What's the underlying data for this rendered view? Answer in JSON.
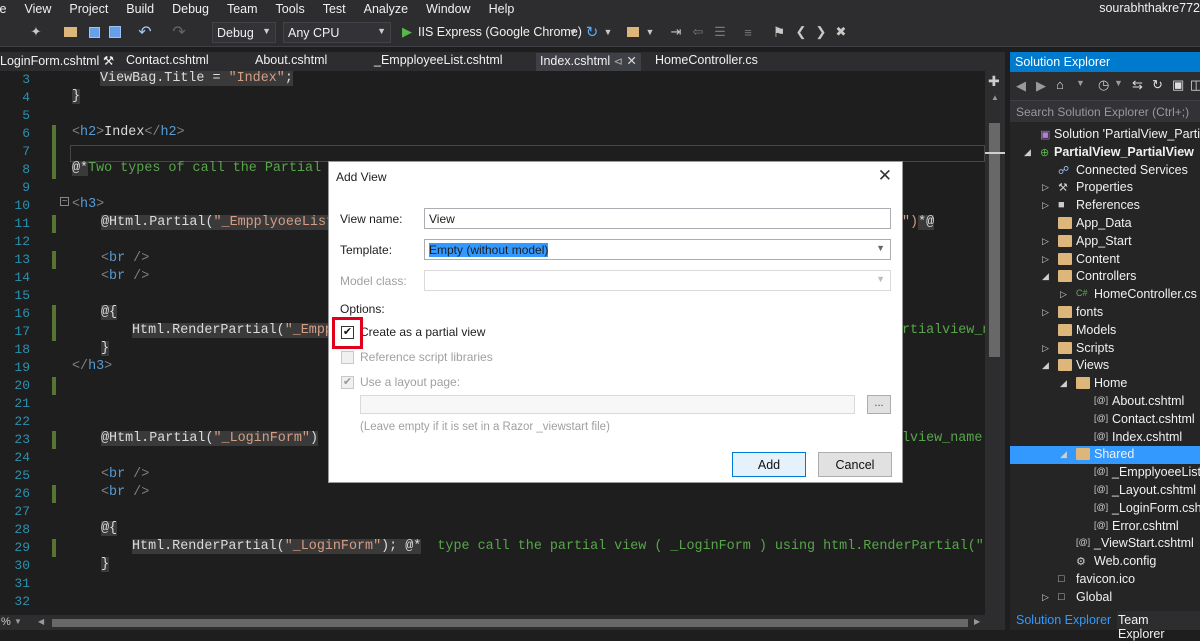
{
  "menu": [
    "ile",
    "View",
    "Project",
    "Build",
    "Debug",
    "Team",
    "Tools",
    "Test",
    "Analyze",
    "Window",
    "Help"
  ],
  "user": "sourabhthakre772",
  "toolbar": {
    "config": "Debug",
    "platform": "Any CPU",
    "run_target": "IIS Express (Google Chrome)"
  },
  "doc_tabs": [
    {
      "label": "LoginForm.cshtml",
      "pin": "⚒"
    },
    {
      "label": "Contact.cshtml"
    },
    {
      "label": "About.cshtml"
    },
    {
      "label": "_EmpployeeList.cshtml"
    },
    {
      "label": "Index.cshtml",
      "active": true
    },
    {
      "label": "HomeController.cs"
    }
  ],
  "code": [
    {
      "n": "3",
      "t": "ViewBag.Title = \"Index\";"
    },
    {
      "n": "4",
      "t": "}"
    },
    {
      "n": "5",
      "t": ""
    },
    {
      "n": "6",
      "t": "<h2>Index</h2>"
    },
    {
      "n": "7",
      "t": ""
    },
    {
      "n": "8",
      "t": "@*Two types of call the Partial V"
    },
    {
      "n": "9",
      "t": ""
    },
    {
      "n": "10",
      "t": "<h3>"
    },
    {
      "n": "11",
      "t": "@Html.Partial(\"_EmpplyoeeList\""
    },
    {
      "n": "12",
      "t": ""
    },
    {
      "n": "13",
      "t": "<br />"
    },
    {
      "n": "14",
      "t": "<br />"
    },
    {
      "n": "15",
      "t": ""
    },
    {
      "n": "16",
      "t": "@{"
    },
    {
      "n": "17",
      "t": "Html.RenderPartial(\"_Empp"
    },
    {
      "n": "18",
      "t": "}"
    },
    {
      "n": "19",
      "t": "</h3>"
    },
    {
      "n": "20",
      "t": ""
    },
    {
      "n": "21",
      "t": ""
    },
    {
      "n": "22",
      "t": ""
    },
    {
      "n": "23",
      "t": "@Html.Partial(\"_LoginForm\")"
    },
    {
      "n": "24",
      "t": ""
    },
    {
      "n": "25",
      "t": "<br />"
    },
    {
      "n": "26",
      "t": "<br />"
    },
    {
      "n": "27",
      "t": ""
    },
    {
      "n": "28",
      "t": "@{"
    },
    {
      "n": "29",
      "t": "Html.RenderPartial(\"_LoginForm\"); @*  type call the partial view ( _LoginForm ) using html.RenderPartial(\"partia"
    },
    {
      "n": "30",
      "t": "}"
    },
    {
      "n": "31",
      "t": ""
    },
    {
      "n": "32",
      "t": ""
    }
  ],
  "code_right": {
    "line11": "\")*@",
    "line17": "rtialview_n",
    "line23": "lview_name"
  },
  "solution_explorer": {
    "title": "Solution Explorer",
    "search_placeholder": "Search Solution Explorer (Ctrl+;)",
    "items": [
      {
        "label": "Solution 'PartialView_PartialVie"
      },
      {
        "label": "PartialView_PartialView"
      },
      {
        "label": "Connected Services"
      },
      {
        "label": "Properties"
      },
      {
        "label": "References"
      },
      {
        "label": "App_Data"
      },
      {
        "label": "App_Start"
      },
      {
        "label": "Content"
      },
      {
        "label": "Controllers"
      },
      {
        "label": "HomeController.cs"
      },
      {
        "label": "fonts"
      },
      {
        "label": "Models"
      },
      {
        "label": "Scripts"
      },
      {
        "label": "Views"
      },
      {
        "label": "Home"
      },
      {
        "label": "About.cshtml"
      },
      {
        "label": "Contact.cshtml"
      },
      {
        "label": "Index.cshtml"
      },
      {
        "label": "Shared"
      },
      {
        "label": "_EmpplyoeeList."
      },
      {
        "label": "_Layout.cshtml"
      },
      {
        "label": "_LoginForm.cshtml"
      },
      {
        "label": "Error.cshtml"
      },
      {
        "label": "_ViewStart.cshtml"
      },
      {
        "label": "Web.config"
      },
      {
        "label": "favicon.ico"
      },
      {
        "label": "Global"
      }
    ],
    "bottom_tabs": [
      "Solution Explorer",
      "Team Explorer"
    ]
  },
  "dialog": {
    "title": "Add View",
    "view_name_label": "View name:",
    "view_name_value": "View",
    "template_label": "Template:",
    "template_value": "Empty (without model)",
    "model_class_label": "Model class:",
    "options_label": "Options:",
    "opt_partial": "Create as a partial view",
    "opt_scripts": "Reference script libraries",
    "opt_layout": "Use a layout page:",
    "layout_hint": "(Leave empty if it is set in a Razor _viewstart file)",
    "browse": "...",
    "add": "Add",
    "cancel": "Cancel"
  }
}
